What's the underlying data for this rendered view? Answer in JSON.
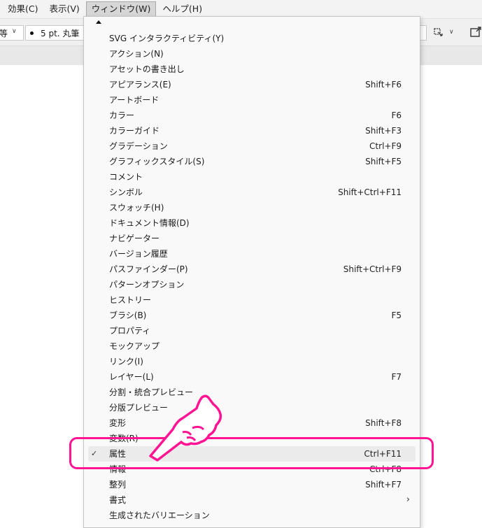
{
  "menubar": {
    "items": [
      {
        "label": "効果(C)",
        "active": false
      },
      {
        "label": "表示(V)",
        "active": false
      },
      {
        "label": "ウィンドウ(W)",
        "active": true
      },
      {
        "label": "ヘルプ(H)",
        "active": false
      }
    ]
  },
  "controlbar": {
    "left_field_value": "等",
    "brush_value": "5 pt. 丸筆"
  },
  "window_menu": {
    "items": [
      {
        "label": "SVG インタラクティビティ(Y)",
        "shortcut": ""
      },
      {
        "label": "アクション(N)",
        "shortcut": ""
      },
      {
        "label": "アセットの書き出し",
        "shortcut": ""
      },
      {
        "label": "アピアランス(E)",
        "shortcut": "Shift+F6"
      },
      {
        "label": "アートボード",
        "shortcut": ""
      },
      {
        "label": "カラー",
        "shortcut": "F6"
      },
      {
        "label": "カラーガイド",
        "shortcut": "Shift+F3"
      },
      {
        "label": "グラデーション",
        "shortcut": "Ctrl+F9"
      },
      {
        "label": "グラフィックスタイル(S)",
        "shortcut": "Shift+F5"
      },
      {
        "label": "コメント",
        "shortcut": ""
      },
      {
        "label": "シンボル",
        "shortcut": "Shift+Ctrl+F11"
      },
      {
        "label": "スウォッチ(H)",
        "shortcut": ""
      },
      {
        "label": "ドキュメント情報(D)",
        "shortcut": ""
      },
      {
        "label": "ナビゲーター",
        "shortcut": ""
      },
      {
        "label": "バージョン履歴",
        "shortcut": ""
      },
      {
        "label": "パスファインダー(P)",
        "shortcut": "Shift+Ctrl+F9"
      },
      {
        "label": "パターンオプション",
        "shortcut": ""
      },
      {
        "label": "ヒストリー",
        "shortcut": ""
      },
      {
        "label": "ブラシ(B)",
        "shortcut": "F5"
      },
      {
        "label": "プロパティ",
        "shortcut": ""
      },
      {
        "label": "モックアップ",
        "shortcut": ""
      },
      {
        "label": "リンク(I)",
        "shortcut": ""
      },
      {
        "label": "レイヤー(L)",
        "shortcut": "F7"
      },
      {
        "label": "分割・統合プレビュー",
        "shortcut": ""
      },
      {
        "label": "分版プレビュー",
        "shortcut": ""
      },
      {
        "label": "変形",
        "shortcut": "Shift+F8"
      },
      {
        "label": "変数(R)",
        "shortcut": ""
      },
      {
        "label": "属性",
        "shortcut": "Ctrl+F11",
        "checked": true,
        "highlighted": true
      },
      {
        "label": "情報",
        "shortcut": "Ctrl+F8"
      },
      {
        "label": "整列",
        "shortcut": "Shift+F7"
      },
      {
        "label": "書式",
        "shortcut": "",
        "submenu": true
      },
      {
        "label": "生成されたバリエーション",
        "shortcut": ""
      }
    ],
    "check_glyph": "✓",
    "submenu_glyph": "›"
  },
  "annotation": {
    "highlight_color": "#ff1493",
    "pointer_icon": "pointing-hand-icon"
  }
}
